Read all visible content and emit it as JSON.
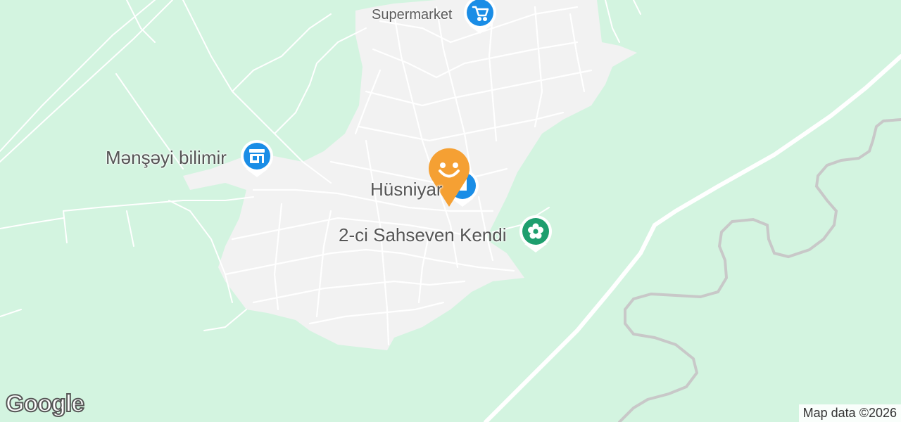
{
  "map": {
    "labels": {
      "supermarket": "Supermarket",
      "mensheyi": "Mənşəyi bilimir",
      "husniyar": "Hüsniyar",
      "sahseven": "2-ci Sahseven Kendi"
    },
    "attribution": "Map data ©2026",
    "logo": "Google"
  },
  "colors": {
    "land": "#d3f4e0",
    "settlement": "#f2f2f2",
    "road": "#ffffff",
    "river": "#c8c8c8",
    "pin_blue": "#1a8de6",
    "pin_green": "#1e9e6e",
    "pin_orange": "#f5a033"
  },
  "icons": [
    "shopping-cart-icon",
    "store-icon",
    "flower-park-icon",
    "smiley-marker-icon"
  ]
}
